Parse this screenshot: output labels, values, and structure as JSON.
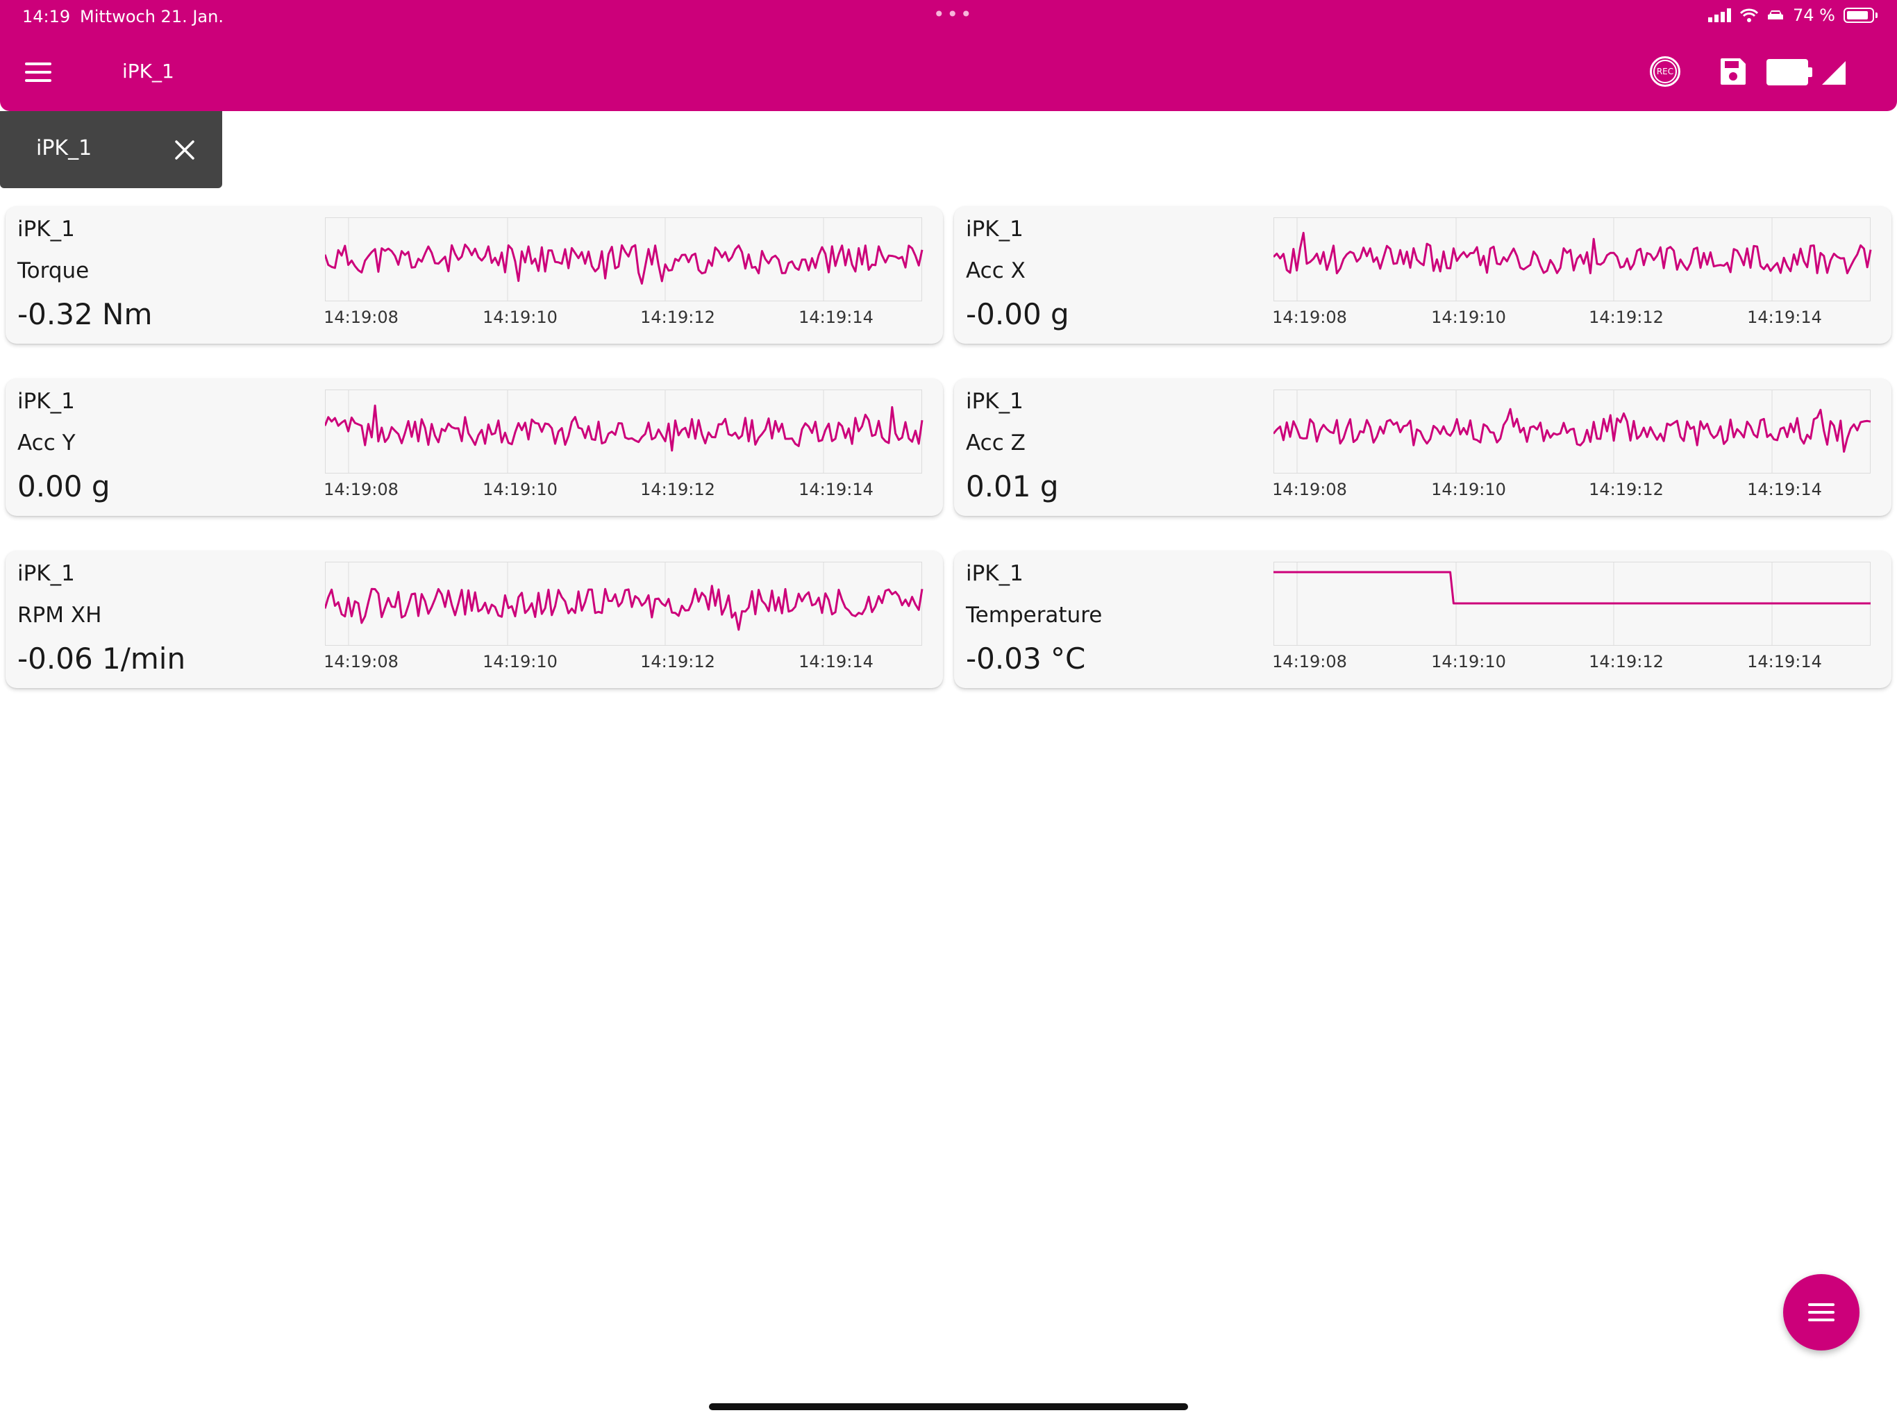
{
  "status_bar": {
    "time": "14:19",
    "date": "Mittwoch 21. Jan.",
    "battery_text": "74 %",
    "battery_level": 0.74
  },
  "app_bar": {
    "title": "iPK_1",
    "rec_label": "REC",
    "color": "#cc007a",
    "icons": [
      "menu-icon",
      "record-icon",
      "save-icon",
      "battery-icon",
      "signal-icon"
    ]
  },
  "device_tab": {
    "label": "iPK_1"
  },
  "chart_style": {
    "line_color": "#cc007a",
    "grid_color": "#dcdcdc"
  },
  "cards": [
    {
      "device": "iPK_1",
      "metric": "Torque",
      "value": "-0.32 Nm",
      "chart_data": {
        "type": "line",
        "x_tick_labels": [
          "14:19:08",
          "14:19:10",
          "14:19:12",
          "14:19:14"
        ],
        "style": "noise",
        "seed": 11,
        "y_range": [
          -1,
          1
        ],
        "values": []
      }
    },
    {
      "device": "iPK_1",
      "metric": "Acc X",
      "value": "-0.00 g",
      "chart_data": {
        "type": "line",
        "x_tick_labels": [
          "14:19:08",
          "14:19:10",
          "14:19:12",
          "14:19:14"
        ],
        "style": "noise",
        "seed": 23,
        "y_range": [
          -1,
          1
        ],
        "values": []
      }
    },
    {
      "device": "iPK_1",
      "metric": "Acc Y",
      "value": "0.00 g",
      "chart_data": {
        "type": "line",
        "x_tick_labels": [
          "14:19:08",
          "14:19:10",
          "14:19:12",
          "14:19:14"
        ],
        "style": "noise",
        "seed": 37,
        "y_range": [
          -1,
          1
        ],
        "values": []
      }
    },
    {
      "device": "iPK_1",
      "metric": "Acc Z",
      "value": "0.01 g",
      "chart_data": {
        "type": "line",
        "x_tick_labels": [
          "14:19:08",
          "14:19:10",
          "14:19:12",
          "14:19:14"
        ],
        "style": "noise",
        "seed": 41,
        "y_range": [
          -1,
          1
        ],
        "values": []
      }
    },
    {
      "device": "iPK_1",
      "metric": "RPM XH",
      "value": "-0.06 1/min",
      "chart_data": {
        "type": "line",
        "x_tick_labels": [
          "14:19:08",
          "14:19:10",
          "14:19:12",
          "14:19:14"
        ],
        "style": "noise",
        "seed": 53,
        "y_range": [
          -1,
          1
        ],
        "values": []
      }
    },
    {
      "device": "iPK_1",
      "metric": "Temperature",
      "value": "-0.03 °C",
      "chart_data": {
        "type": "line",
        "x_tick_labels": [
          "14:19:08",
          "14:19:10",
          "14:19:12",
          "14:19:14"
        ],
        "style": "step",
        "step_levels": [
          0.75,
          0.0
        ],
        "step_at": 0.295,
        "y_range": [
          -1,
          1
        ],
        "values": []
      }
    }
  ]
}
